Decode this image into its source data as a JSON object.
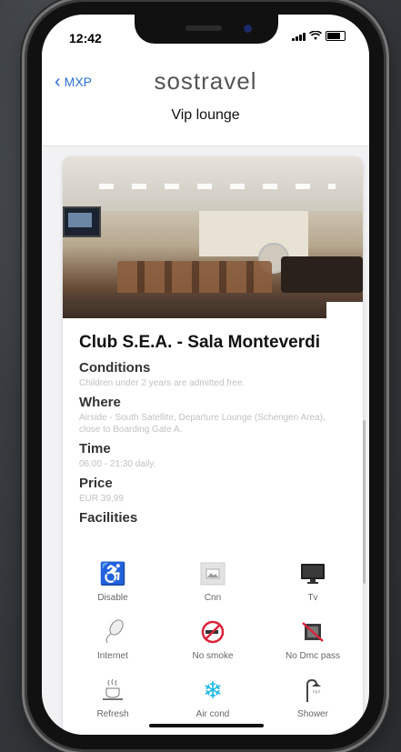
{
  "status": {
    "time": "12:42"
  },
  "nav": {
    "back_label": "MXP",
    "brand": "sostravel",
    "subtitle": "Vip lounge"
  },
  "lounge": {
    "name": "Club S.E.A. - Sala Monteverdi",
    "sections": [
      {
        "label": "Conditions",
        "value": "Children under 2 years are admitted free."
      },
      {
        "label": "Where",
        "value": "Airside - South Satellite, Departure Lounge (Schengen Area), close to Boarding Gate A."
      },
      {
        "label": "Time",
        "value": "06:00 - 21:30 daily."
      },
      {
        "label": "Price",
        "value": "EUR 39,99"
      }
    ],
    "facilities_label": "Facilities",
    "facilities": [
      {
        "label": "Disable",
        "icon": "wheelchair-icon"
      },
      {
        "label": "Cnn",
        "icon": "image-icon"
      },
      {
        "label": "Tv",
        "icon": "tv-icon"
      },
      {
        "label": "Internet",
        "icon": "mouse-icon"
      },
      {
        "label": "No smoke",
        "icon": "no-smoking-icon"
      },
      {
        "label": "No Dmc pass",
        "icon": "no-pass-icon"
      },
      {
        "label": "Refresh",
        "icon": "coffee-icon"
      },
      {
        "label": "Air cond",
        "icon": "snowflake-icon"
      },
      {
        "label": "Shower",
        "icon": "shower-icon"
      }
    ]
  },
  "colors": {
    "accent": "#2b6fd6",
    "wheelchair": "#3a4fa8",
    "no_smoke": "#d9233b",
    "snowflake": "#19b7e6"
  }
}
